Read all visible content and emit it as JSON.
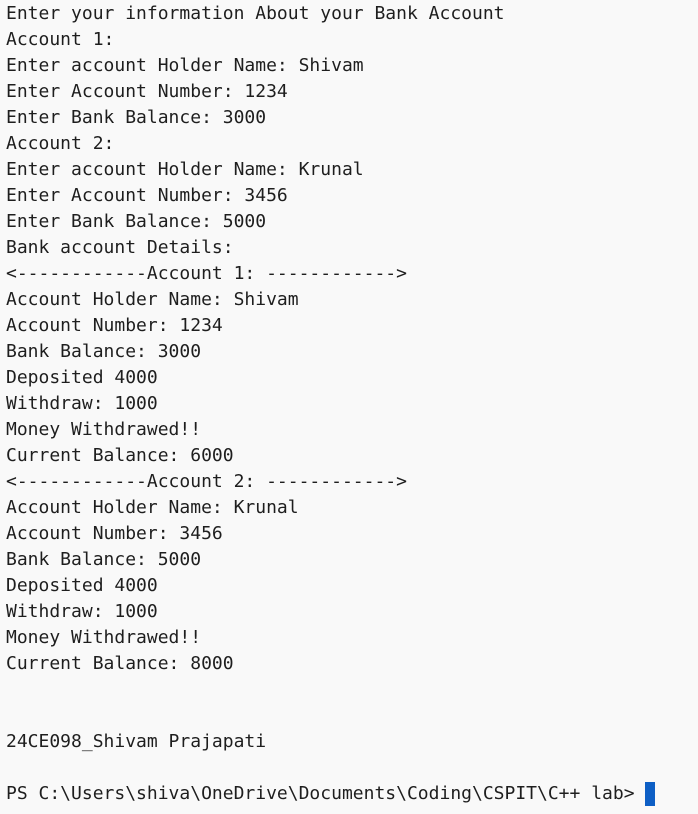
{
  "lines": [
    "Enter your information About your Bank Account",
    "Account 1:",
    "Enter account Holder Name: Shivam",
    "Enter Account Number: 1234",
    "Enter Bank Balance: 3000",
    "Account 2:",
    "Enter account Holder Name: Krunal",
    "Enter Account Number: 3456",
    "Enter Bank Balance: 5000",
    "Bank account Details:",
    "<------------Account 1: ------------>",
    "Account Holder Name: Shivam",
    "Account Number: 1234",
    "Bank Balance: 3000",
    "Deposited 4000",
    "Withdraw: 1000",
    "Money Withdrawed!!",
    "Current Balance: 6000",
    "<------------Account 2: ------------>",
    "Account Holder Name: Krunal",
    "Account Number: 3456",
    "Bank Balance: 5000",
    "Deposited 4000",
    "Withdraw: 1000",
    "Money Withdrawed!!",
    "Current Balance: 8000"
  ],
  "footer_id": "24CE098_Shivam Prajapati",
  "prompt": "PS C:\\Users\\shiva\\OneDrive\\Documents\\Coding\\CSPIT\\C++ lab>",
  "colors": {
    "background": "#f9f9f9",
    "text": "#1e1e1e",
    "cursor": "#0e5fc5"
  }
}
